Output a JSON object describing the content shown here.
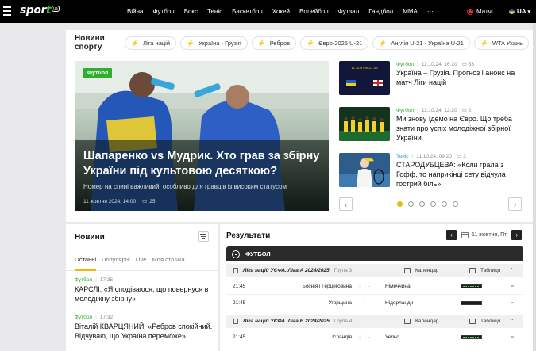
{
  "header": {
    "logo": "sport",
    "logo_suffix": "ua",
    "nav": [
      "Війна",
      "Футбол",
      "Бокс",
      "Теніс",
      "Баскетбол",
      "Хокей",
      "Волейбол",
      "Футзал",
      "Гандбол",
      "MMA"
    ],
    "more": "···",
    "matches_label": "Матчі",
    "lang": "UA",
    "lang_arrow": "▾"
  },
  "news_bar": {
    "title": "Новини спорту",
    "chips": [
      "Ліга націй",
      "Україна - Грузія",
      "Ребров",
      "Євро-2025 U-21",
      "Англія U-21 - Україна U-21",
      "WTA Ухань"
    ]
  },
  "hero": {
    "tag": "Футбол",
    "title": "Шапаренко vs Мудрик. Хто грав за збірну України під культовою десяткою?",
    "subtitle": "Номер на спині важливий, особливо для гравців із високим статусом",
    "date": "11 жовтня 2024, 14:00",
    "comments": "25"
  },
  "side_news": [
    {
      "category": "Футбол",
      "time": "11.10.24, 16:20",
      "comments": "53",
      "title": "Україна – Грузія. Прогноз і анонс на матч Ліги націй",
      "thumb_text": "11 жовтня 21:45",
      "color": "green"
    },
    {
      "category": "Футбол",
      "time": "11.10.24, 12:20",
      "comments": "2",
      "title": "Ми знову їдемо на Євро. Що треба знати про успіх молодіжної збірної України",
      "thumb_text": "",
      "color": "green"
    },
    {
      "category": "Теніс",
      "time": "11.10.24, 09:20",
      "comments": "3",
      "title": "СТАРОДУБЦЕВА: «Коли грала з Гофф, то наприкінці сету відчула гострий біль»",
      "thumb_text": "",
      "color": "blue"
    }
  ],
  "pager": {
    "prev": "‹",
    "next": "›",
    "active": 0,
    "count": 6
  },
  "news": {
    "title": "Новини",
    "tabs": [
      "Останні",
      "Популярні",
      "Live",
      "Моя стрічка"
    ],
    "active_tab": "Останні",
    "items": [
      {
        "category": "Футбол",
        "time": "17:35",
        "text": "КАРСЛІ: «Я сподіваюся, що повернуся в молодіжну збірну»"
      },
      {
        "category": "Футбол",
        "time": "17:32",
        "text": "Віталій КВАРЦЯНИЙ: «Ребров спокійний. Відчуваю, що Україна переможе»"
      }
    ]
  },
  "results": {
    "title": "Результати",
    "date": "11 жовтня, Пт",
    "prev": "‹",
    "next": "›",
    "sport": "ФУТБОЛ",
    "calendar_label": "Календар",
    "table_label": "Таблиця",
    "leagues": [
      {
        "name": "Ліга націй УЄФА. Ліга A 2024/2025",
        "group": "Група 3",
        "matches": [
          {
            "time": "21:45",
            "home": "Боснія і Герцеговина",
            "score": "- : -",
            "away": "Німеччина"
          },
          {
            "time": "21:45",
            "home": "Угорщина",
            "score": "- : -",
            "away": "Нідерланди"
          }
        ]
      },
      {
        "name": "Ліга націй УЄФА. Ліга B 2024/2025",
        "group": "Група 4",
        "matches": [
          {
            "time": "21:45",
            "home": "Ісландія",
            "score": "- : -",
            "away": "Уельс"
          }
        ]
      }
    ]
  },
  "colors": {
    "accent": "#f0b800",
    "green": "#2fae2f",
    "blue": "#2ca0d9",
    "topbar": "#000000"
  }
}
